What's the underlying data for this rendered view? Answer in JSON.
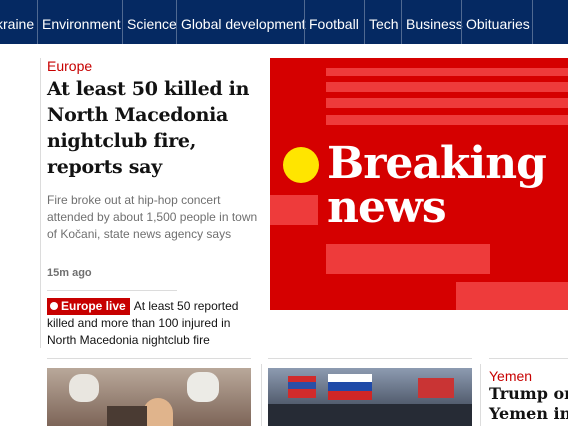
{
  "nav": {
    "items": [
      "kraine",
      "Environment",
      "Science",
      "Global development",
      "Football",
      "Tech",
      "Business",
      "Obituaries"
    ]
  },
  "lead": {
    "kicker": "Europe",
    "headline": "At least 50 killed in North Macedonia nightclub fire, reports say",
    "standfirst": "Fire broke out at hip-hop concert attended by about 1,500 people in town of Kočani, state news agency says",
    "timestamp": "15m ago",
    "live_badge": "Europe live",
    "live_text": "At least 50 reported killed and more than 100 injured in North Macedonia nightclub fire"
  },
  "breaking": {
    "line1": "Breaking",
    "line2": "news"
  },
  "cards": {
    "yemen_kicker": "Yemen",
    "yemen_line1": "Trump orde",
    "yemen_line2": "Yemen in w"
  },
  "colors": {
    "nav_bg": "#052962",
    "accent_red": "#c70000",
    "breaking_red": "#d50000",
    "breaking_dot": "#ffe500"
  }
}
